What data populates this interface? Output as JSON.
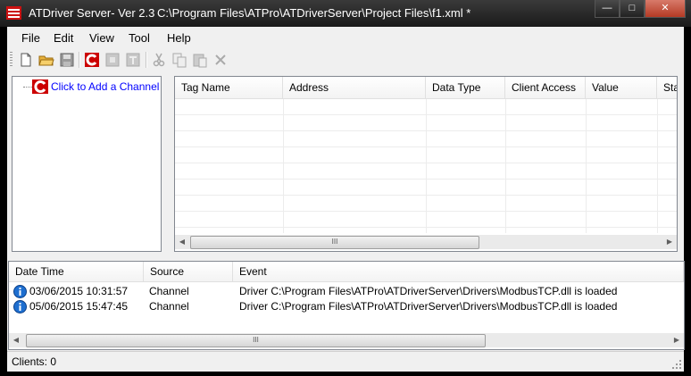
{
  "window": {
    "app_title": "ATDriver Server- Ver 2.3",
    "file_path": "C:\\Program Files\\ATPro\\ATDriverServer\\Project Files\\f1.xml *",
    "controls": {
      "minimize": "—",
      "maximize": "□",
      "close": "✕"
    }
  },
  "menu": {
    "file": "File",
    "edit": "Edit",
    "view": "View",
    "tool": "Tool",
    "help": "Help"
  },
  "toolbar": {
    "icons": [
      "new-file-icon",
      "open-folder-icon",
      "save-icon",
      "add-channel-icon",
      "add-device-icon",
      "add-tag-icon",
      "cut-icon",
      "copy-icon",
      "paste-icon",
      "delete-icon"
    ]
  },
  "tree": {
    "root_label": "Click to Add a Channel",
    "accent": "#cc0000"
  },
  "tag_table": {
    "columns": [
      "Tag Name",
      "Address",
      "Data Type",
      "Client Access",
      "Value",
      "Sta"
    ],
    "rows": [],
    "scroll": {
      "left": "◀",
      "right": "▶",
      "thumb": "III"
    }
  },
  "event_log": {
    "columns": [
      "Date Time",
      "Source",
      "Event"
    ],
    "rows": [
      {
        "datetime": "03/06/2015 10:31:57",
        "source": "Channel",
        "event": "Driver C:\\Program Files\\ATPro\\ATDriverServer\\Drivers\\ModbusTCP.dll is loaded"
      },
      {
        "datetime": "05/06/2015 15:47:45",
        "source": "Channel",
        "event": "Driver C:\\Program Files\\ATPro\\ATDriverServer\\Drivers\\ModbusTCP.dll is loaded"
      }
    ],
    "scroll": {
      "left": "◀",
      "right": "▶",
      "thumb": "III"
    }
  },
  "status": {
    "clients": "Clients: 0"
  },
  "colors": {
    "info_icon": "#1e6fd0",
    "link": "#0000ff"
  }
}
